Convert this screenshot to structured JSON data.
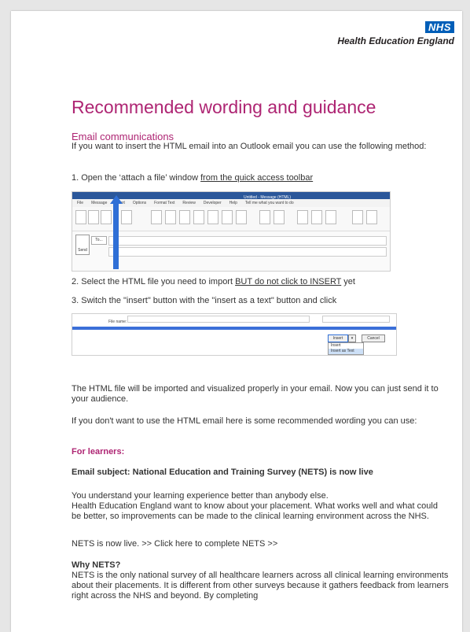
{
  "header": {
    "nhs_logo": "NHS",
    "org_name": "Health Education England"
  },
  "title": "Recommended wording and guidance",
  "email_section": {
    "heading": "Email communications",
    "intro": "If you want to insert the HTML email into an Outlook email you can use the following method:",
    "step1_prefix": "1. Open the ‘attach a file’ window ",
    "step1_link": "from the quick access toolbar",
    "step2_prefix": "2. Select the HTML file you need to import ",
    "step2_link": "BUT do not click to INSERT",
    "step2_suffix": " yet",
    "step3": "3. Switch the \"insert\" button with the \"insert as a text\" button and click",
    "result": "The HTML file will be imported and visualized properly in your email. Now you can just send it to your audience.",
    "alt": "If you don't want to use the HTML email here is some recommended wording you can use:"
  },
  "outlook_screenshot": {
    "title_text": "Untitled - Message (HTML)",
    "tabs": [
      "File",
      "Message",
      "Insert",
      "Options",
      "Format Text",
      "Review",
      "Developer",
      "Help",
      "Tell me what you want to do"
    ],
    "to_label": "To...",
    "send_label": "Send"
  },
  "insert_dialog": {
    "file_name_label": "File name:",
    "insert_label": "Insert",
    "cancel_label": "Cancel",
    "menu_insert": "Insert",
    "menu_insert_as_text": "Insert as Text"
  },
  "learners": {
    "heading": "For learners:",
    "subject": "Email subject: National Education and Training Survey (NETS) is now live",
    "body1": "You understand your learning experience better than anybody else.",
    "body2": "Health Education England want to know about your placement. What works well and what could be better, so improvements can be made to the clinical learning environment across the NHS.",
    "cta": "NETS is now live. >> Click here to complete NETS >>",
    "why_heading": "Why NETS?",
    "why_body": "NETS is the only national survey of all healthcare learners across all clinical learning environments about their placements. It is different from other surveys because it gathers feedback from learners right across the NHS and beyond. By completing"
  },
  "colors": {
    "nhs_blue": "#005eb8",
    "accent_pink": "#ae2573",
    "arrow_blue": "#2f6fd6"
  }
}
